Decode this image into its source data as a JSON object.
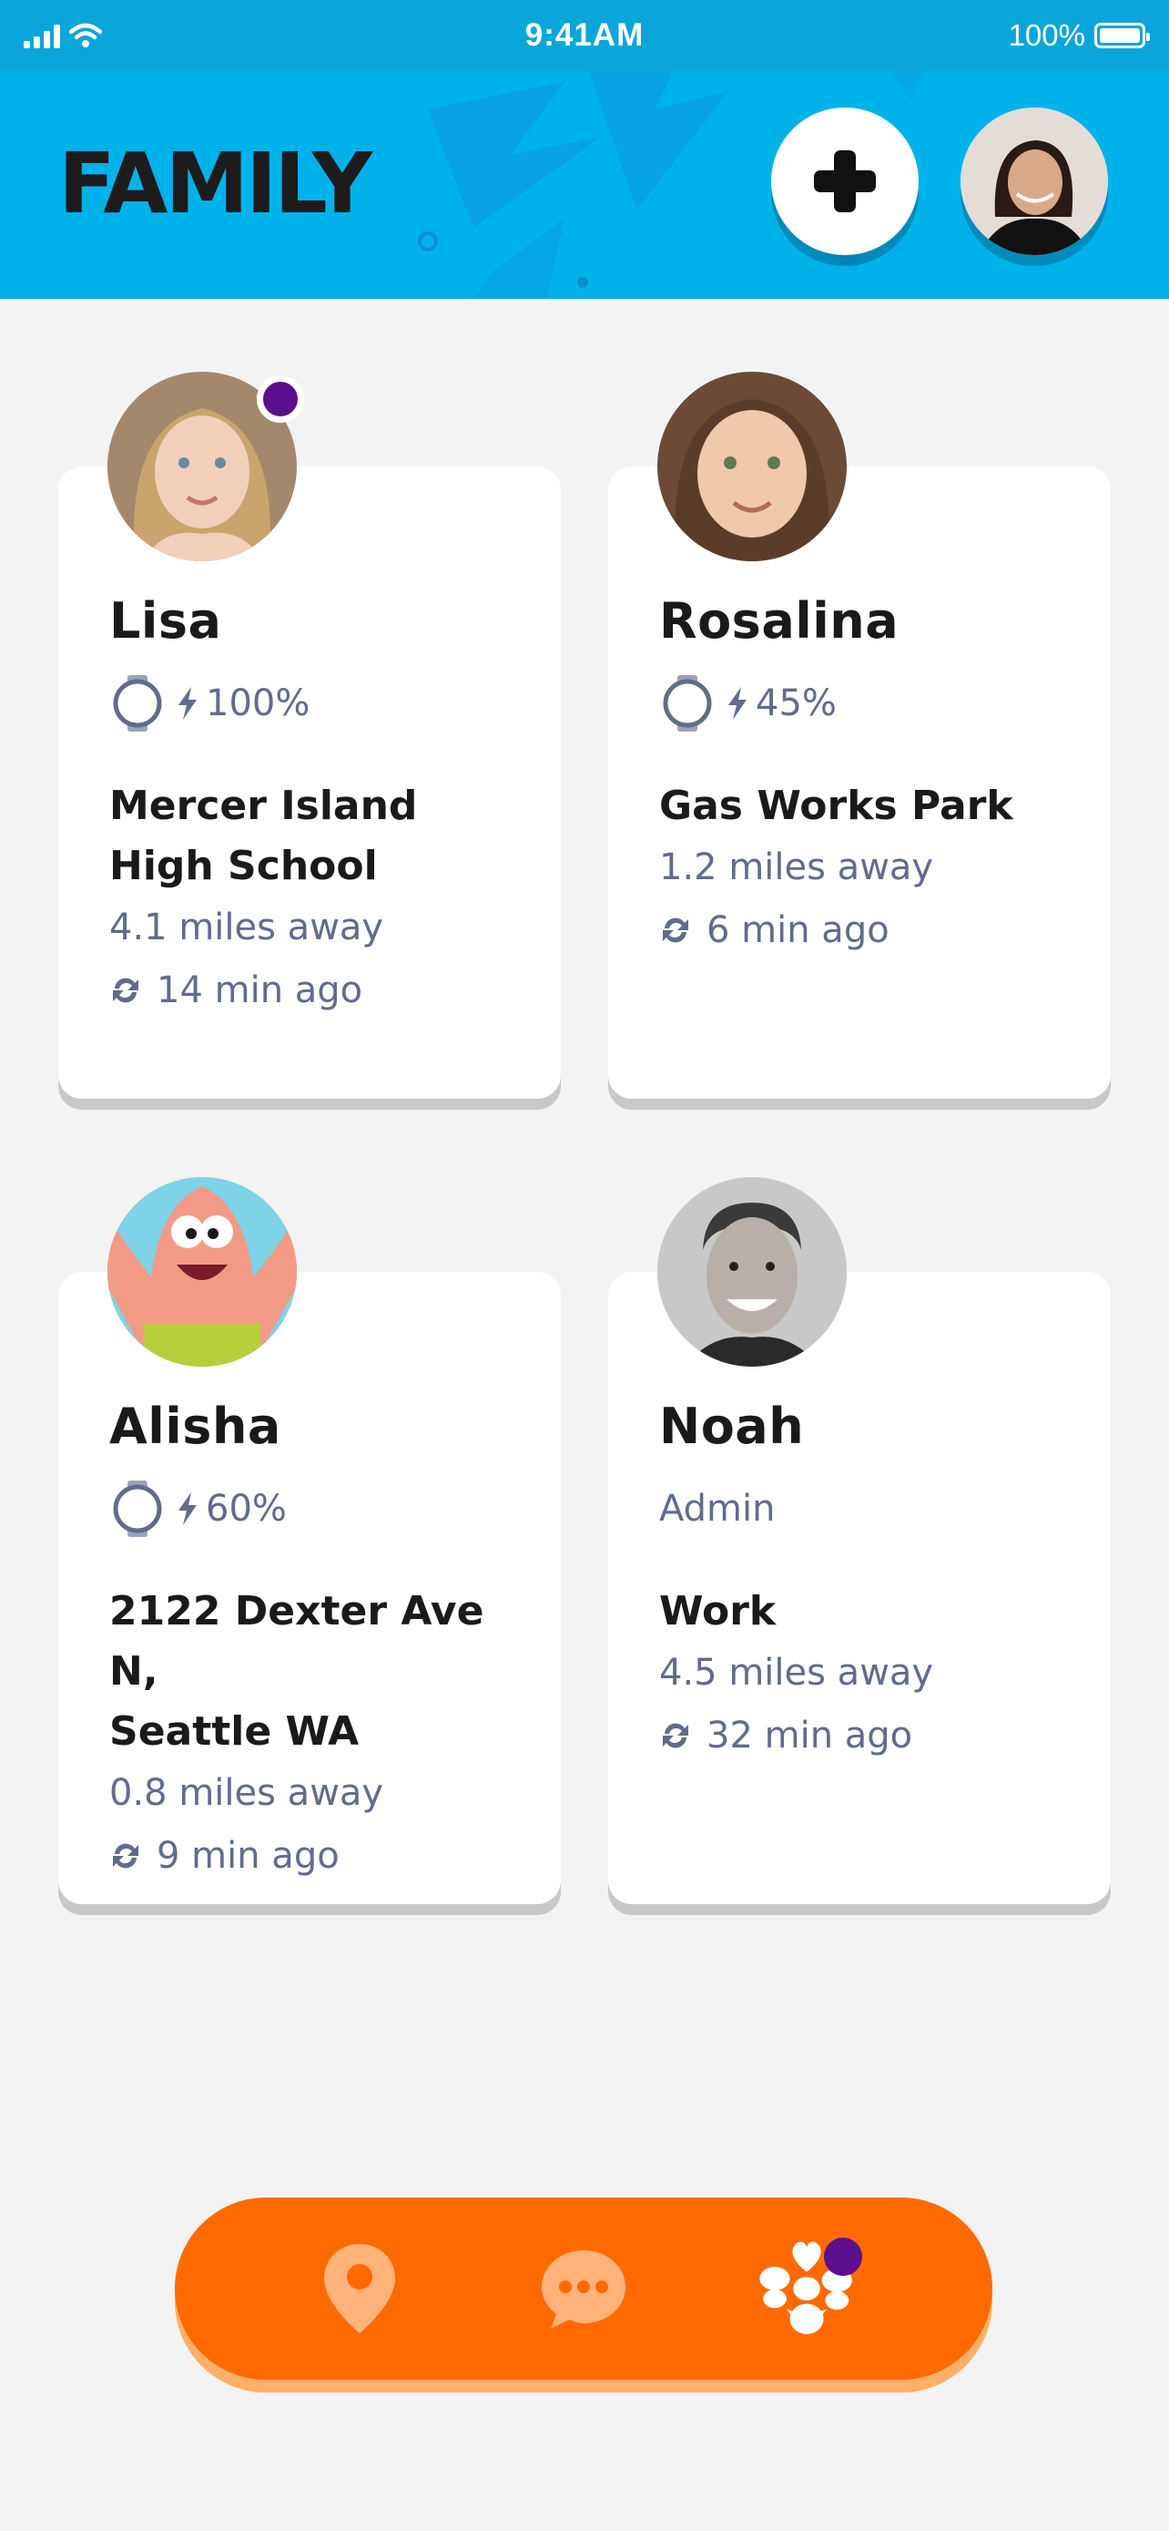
{
  "status_bar": {
    "time": "9:41AM",
    "battery": "100%"
  },
  "header": {
    "title": "FAMILY"
  },
  "members": [
    {
      "name": "Lisa",
      "battery": "100%",
      "place": "Mercer Island High School",
      "place_line1": "Mercer Island",
      "place_line2": "High School",
      "distance": "4.1 miles away",
      "updated": "14 min ago",
      "has_notification": true
    },
    {
      "name": "Rosalina",
      "battery": "45%",
      "place": "Gas Works Park",
      "place_line1": "Gas Works Park",
      "place_line2": "",
      "distance": "1.2 miles away",
      "updated": "6 min ago"
    },
    {
      "name": "Alisha",
      "battery": "60%",
      "place": "2122 Dexter Ave N, Seattle WA",
      "place_line1": "2122 Dexter Ave N,",
      "place_line2": "Seattle WA",
      "distance": "0.8 miles away",
      "updated": "9 min ago"
    },
    {
      "name": "Noah",
      "role": "Admin",
      "place": "Work",
      "place_line1": "Work",
      "place_line2": "",
      "distance": "4.5 miles away",
      "updated": "32 min ago"
    }
  ],
  "bottom_nav": {
    "items": [
      {
        "icon": "location-pin-icon",
        "active": false
      },
      {
        "icon": "chat-bubble-icon",
        "active": false
      },
      {
        "icon": "family-group-icon",
        "active": true,
        "badge": true
      }
    ]
  },
  "colors": {
    "header_bg": "#00b2ea",
    "nav_bg": "#ff6a00",
    "badge": "#5b0f8c",
    "muted_text": "#616b8c"
  }
}
